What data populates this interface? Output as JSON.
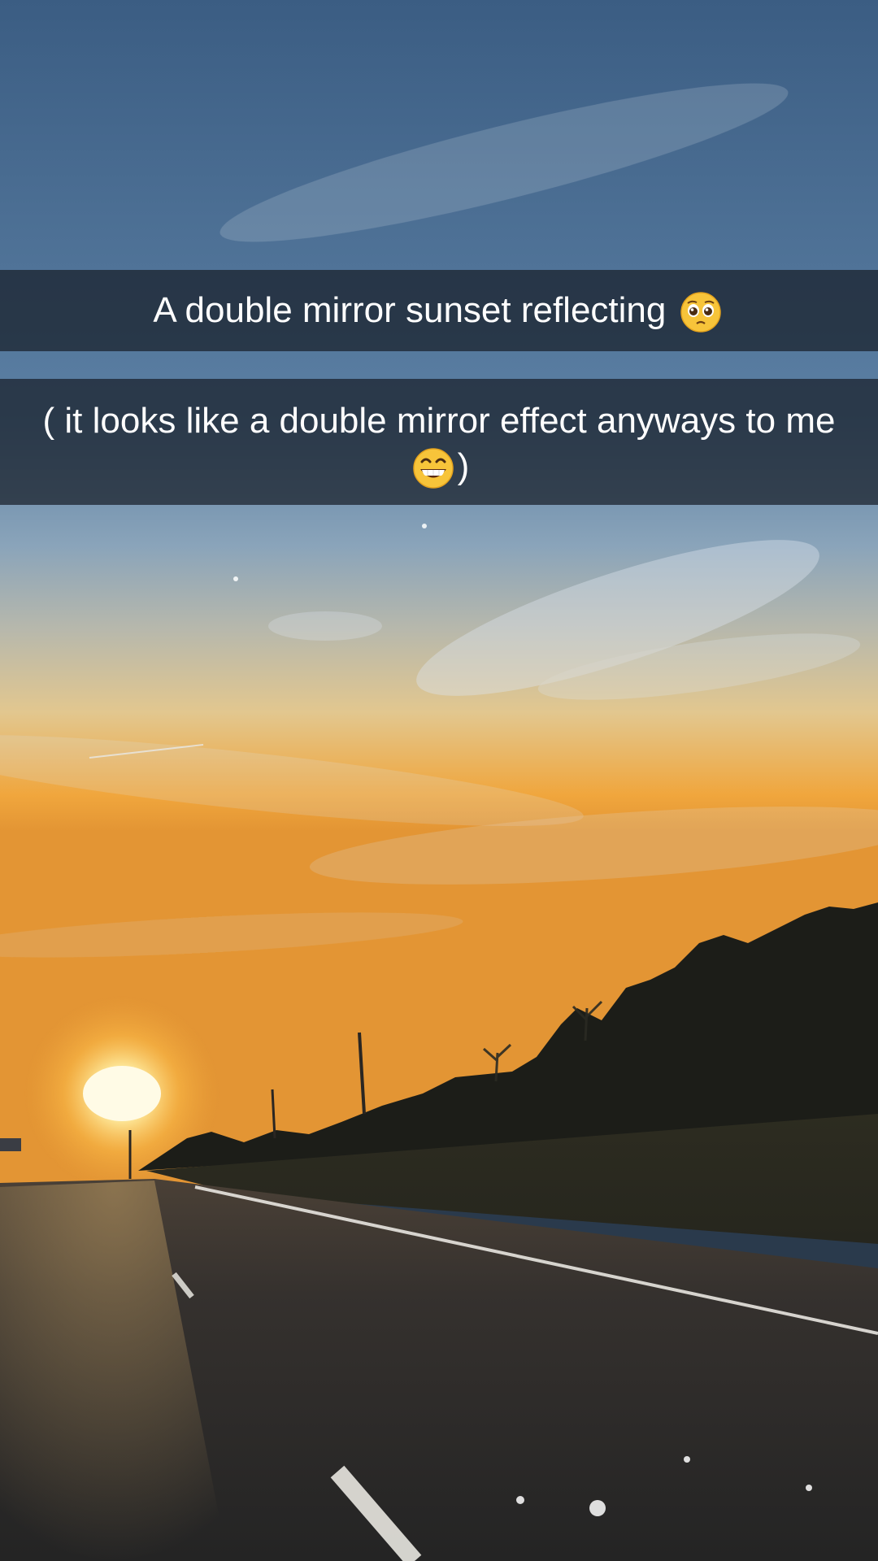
{
  "snap": {
    "caption_1": {
      "text": "A double mirror sunset reflecting",
      "emoji": "pleading-face-icon"
    },
    "caption_2": {
      "text_before": "( it looks like a double mirror effect anyways to me",
      "emoji": "grinning-face-icon",
      "text_after": ")"
    }
  },
  "colors": {
    "sky_top": "#3f6287",
    "sky_mid": "#7d9bb6",
    "horizon": "#f0a63d",
    "sun": "#fff6c2",
    "road": "#2b2a2a",
    "treeline": "#1e1f1a",
    "caption_bg": "#171e28"
  }
}
